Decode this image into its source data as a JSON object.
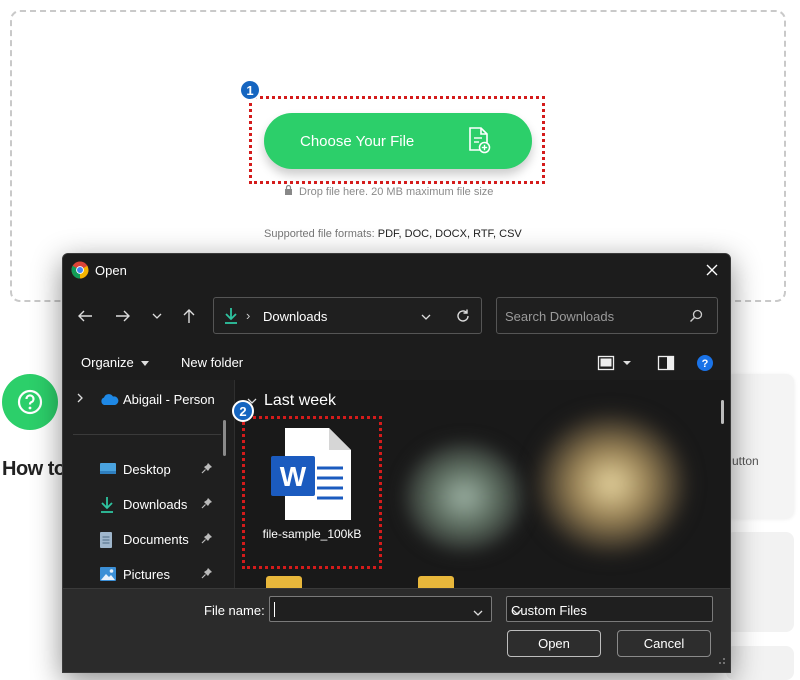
{
  "page": {
    "choose_button_label": "Choose Your File",
    "drop_note": "Drop file here. 20 MB maximum file size",
    "supported_prefix": "Supported file formats: ",
    "supported_formats": "PDF, DOC, DOCX, RTF, CSV",
    "howto_heading": "How to",
    "side_card_text": "utton",
    "step_badges": [
      "1",
      "2"
    ]
  },
  "dialog": {
    "title": "Open",
    "address": {
      "path": "Downloads"
    },
    "search": {
      "placeholder": "Search Downloads"
    },
    "commands": {
      "organize": "Organize",
      "new_folder": "New folder"
    },
    "tree": {
      "onedrive": "Abigail - Person",
      "items": [
        {
          "label": "Desktop",
          "icon": "desktop-icon"
        },
        {
          "label": "Downloads",
          "icon": "download-icon"
        },
        {
          "label": "Documents",
          "icon": "document-icon"
        },
        {
          "label": "Pictures",
          "icon": "picture-icon"
        }
      ]
    },
    "group_header": "Last week",
    "file": {
      "name": "file-sample_100kB",
      "icon": "word-doc-icon"
    },
    "footer": {
      "file_name_label": "File name:",
      "file_name_value": "",
      "file_type": "Custom Files",
      "open_label": "Open",
      "cancel_label": "Cancel"
    }
  },
  "colors": {
    "accent_green": "#2ccf6a",
    "highlight_red": "#d41b1b",
    "badge_blue": "#1565c0",
    "dialog_bg": "#202020"
  }
}
